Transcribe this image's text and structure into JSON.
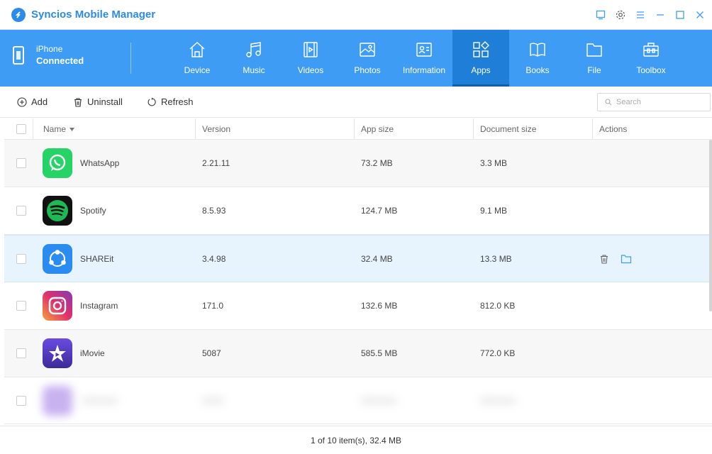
{
  "app": {
    "title": "Syncios Mobile Manager"
  },
  "device": {
    "name": "iPhone",
    "status": "Connected"
  },
  "nav": {
    "tabs": [
      {
        "label": "Device",
        "icon": "home-icon"
      },
      {
        "label": "Music",
        "icon": "music-icon"
      },
      {
        "label": "Videos",
        "icon": "video-icon"
      },
      {
        "label": "Photos",
        "icon": "photo-icon"
      },
      {
        "label": "Information",
        "icon": "contact-card-icon"
      },
      {
        "label": "Apps",
        "icon": "apps-icon",
        "active": true
      },
      {
        "label": "Books",
        "icon": "book-icon"
      },
      {
        "label": "File",
        "icon": "folder-icon"
      },
      {
        "label": "Toolbox",
        "icon": "toolbox-icon"
      }
    ]
  },
  "toolbar": {
    "add": "Add",
    "uninstall": "Uninstall",
    "refresh": "Refresh",
    "search_placeholder": "Search"
  },
  "table": {
    "headers": {
      "name": "Name",
      "version": "Version",
      "app_size": "App size",
      "document_size": "Document size",
      "actions": "Actions"
    },
    "rows": [
      {
        "name": "WhatsApp",
        "version": "2.21.11",
        "app_size": "73.2 MB",
        "document_size": "3.3 MB",
        "icon": "whatsapp-icon"
      },
      {
        "name": "Spotify",
        "version": "8.5.93",
        "app_size": "124.7 MB",
        "document_size": "9.1 MB",
        "icon": "spotify-icon"
      },
      {
        "name": "SHAREit",
        "version": "3.4.98",
        "app_size": "32.4 MB",
        "document_size": "13.3 MB",
        "icon": "shareit-icon",
        "selected": true
      },
      {
        "name": "Instagram",
        "version": "171.0",
        "app_size": "132.6 MB",
        "document_size": "812.0 KB",
        "icon": "instagram-icon"
      },
      {
        "name": "iMovie",
        "version": "5087",
        "app_size": "585.5 MB",
        "document_size": "772.0 KB",
        "icon": "imovie-icon"
      }
    ]
  },
  "footer": {
    "status": "1 of 10 item(s), 32.4 MB"
  },
  "colors": {
    "accent": "#3e9cf4",
    "nav_active": "#1f7fd8",
    "selected_row": "#e8f4fd"
  }
}
